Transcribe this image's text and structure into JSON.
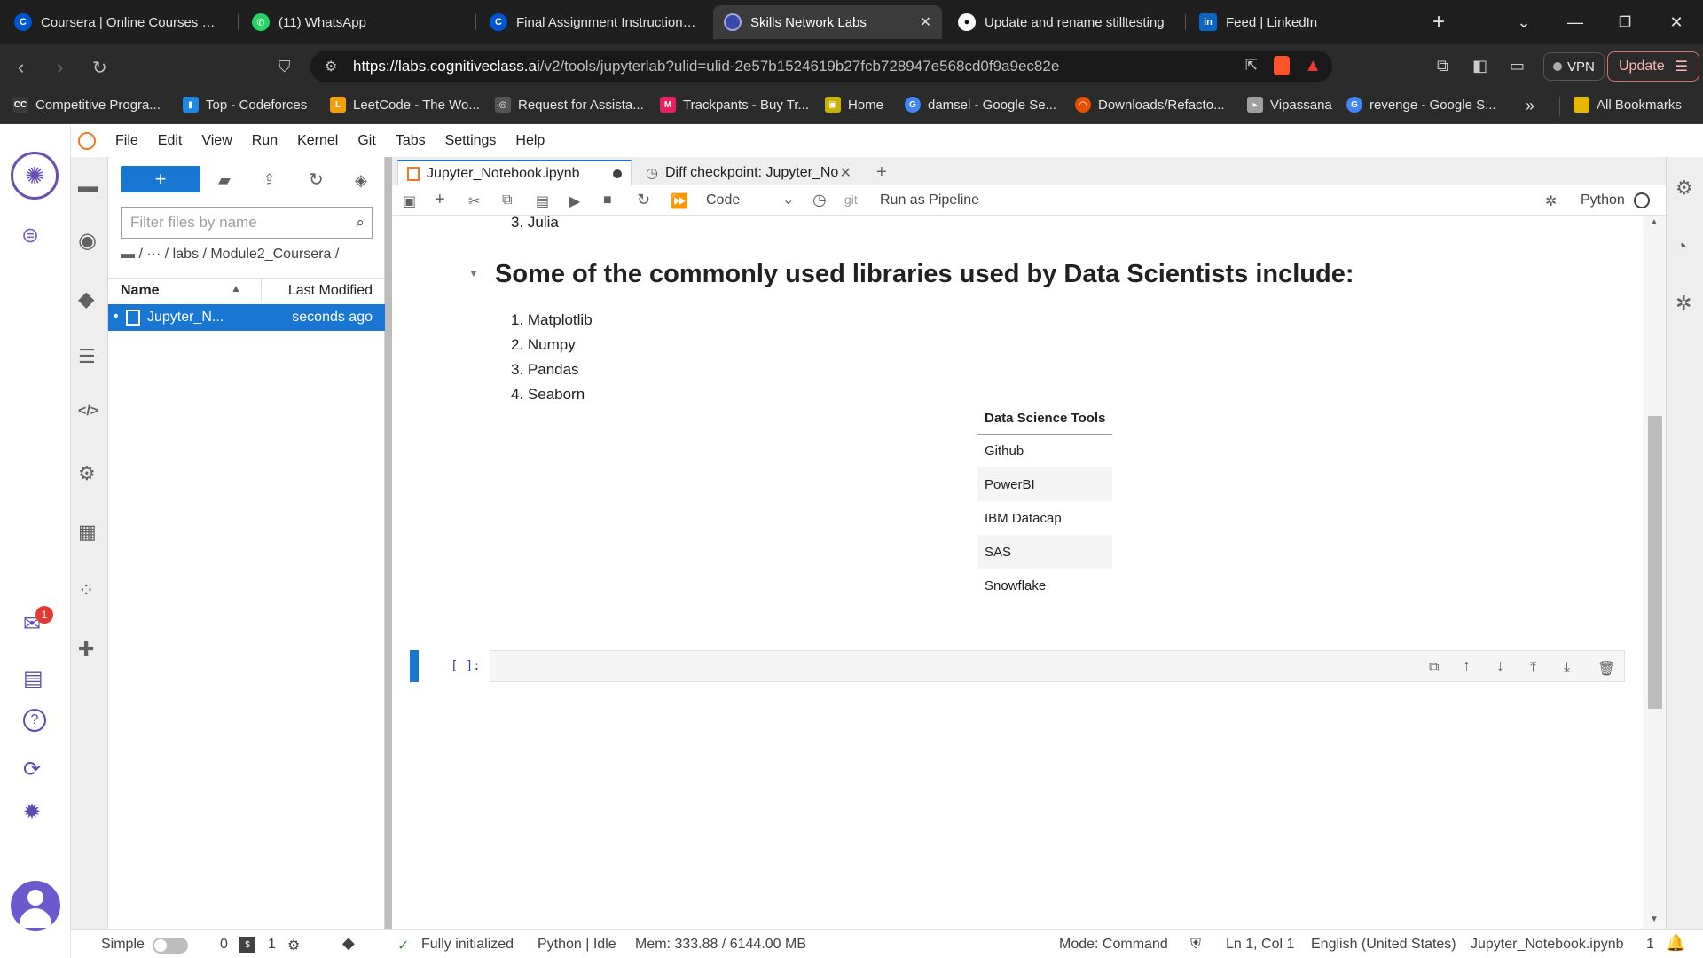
{
  "browser": {
    "tabs": [
      {
        "title": "Coursera | Online Courses From",
        "icon": "coursera-icon"
      },
      {
        "title": "(11) WhatsApp",
        "icon": "whatsapp-icon"
      },
      {
        "title": "Final Assignment Instructions: C",
        "icon": "coursera-icon"
      },
      {
        "title": "Skills Network Labs",
        "icon": "skills-network-icon",
        "active": true
      },
      {
        "title": "Update and rename stilltesting",
        "icon": "github-icon"
      },
      {
        "title": "Feed | LinkedIn",
        "icon": "linkedin-icon"
      }
    ],
    "url_host": "https://labs.cognitiveclass.ai",
    "url_rest": "/v2/tools/jupyterlab?ulid=ulid-2e57b1524619b27fcb728947e568cd0f9a9ec82e",
    "vpn_label": "VPN",
    "update_label": "Update",
    "bookmarks": [
      {
        "label": "Competitive Progra...",
        "color": "#3a3a3a",
        "glyph": "CC"
      },
      {
        "label": "Top - Codeforces",
        "color": "#1e88e5",
        "glyph": "▮"
      },
      {
        "label": "LeetCode - The Wo...",
        "color": "#f59e0b",
        "glyph": "L"
      },
      {
        "label": "Request for Assista...",
        "color": "#555555",
        "glyph": "◎"
      },
      {
        "label": "Trackpants - Buy Tr...",
        "color": "#e91e63",
        "glyph": "M"
      },
      {
        "label": "Home",
        "color": "#c8b400",
        "glyph": "▣"
      },
      {
        "label": "damsel - Google Se...",
        "color": "#4285f4",
        "glyph": "G"
      },
      {
        "label": "Downloads/Refacto...",
        "color": "#e65100",
        "glyph": "◠"
      },
      {
        "label": "Vipassana",
        "color": "#9e9e9e",
        "glyph": "▸"
      },
      {
        "label": "revenge - Google S...",
        "color": "#4285f4",
        "glyph": "G"
      }
    ],
    "all_bookmarks_label": "All Bookmarks"
  },
  "jupyter": {
    "menu": [
      "File",
      "Edit",
      "View",
      "Run",
      "Kernel",
      "Git",
      "Tabs",
      "Settings",
      "Help"
    ],
    "filter_placeholder": "Filter files by name",
    "breadcrumb": "/   ···   / labs / Module2_Coursera /",
    "file_header": {
      "name": "Name",
      "modified": "Last Modified"
    },
    "files": [
      {
        "name": "Jupyter_N...",
        "modified": "seconds ago"
      }
    ],
    "notebook_tabs": [
      {
        "title": "Jupyter_Notebook.ipynb",
        "dirty": true
      },
      {
        "title": "Diff checkpoint: Jupyter_No"
      }
    ],
    "toolbar": {
      "cell_type": "Code",
      "git_label": "git",
      "pipeline_label": "Run as Pipeline",
      "kernel_label": "Python"
    },
    "content": {
      "prev_item": "3. Julia",
      "heading": "Some of the commonly used libraries used by Data Scientists include:",
      "libraries": [
        "1. Matplotlib",
        "2. Numpy",
        "3. Pandas",
        "4. Seaborn"
      ],
      "table_header": "Data Science Tools",
      "table_rows": [
        "Github",
        "PowerBI",
        "IBM Datacap",
        "SAS",
        "Snowflake"
      ],
      "prompt": "[ ]:"
    },
    "notification_count": "1",
    "status": {
      "simple_label": "Simple",
      "terminals": "0",
      "kernels": "1",
      "init": "Fully initialized",
      "kernel_state": "Python | Idle",
      "mem": "Mem: 333.88 / 6144.00 MB",
      "mode": "Mode: Command",
      "position": "Ln 1, Col 1",
      "language": "English (United States)",
      "file": "Jupyter_Notebook.ipynb",
      "count": "1"
    }
  }
}
